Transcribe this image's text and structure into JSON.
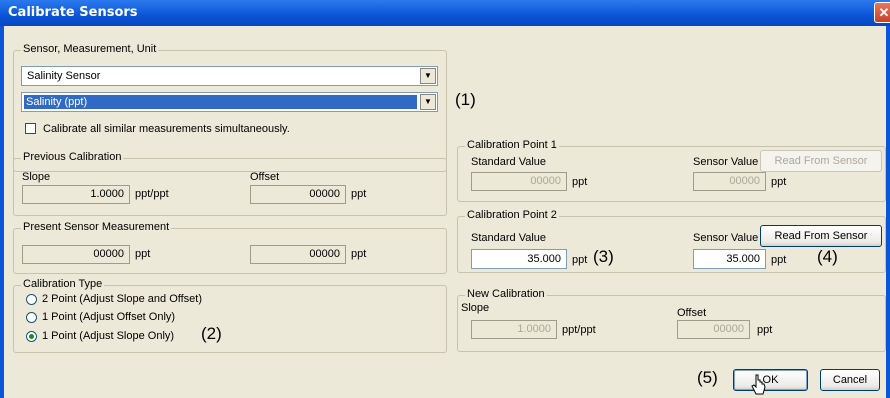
{
  "window": {
    "title": "Calibrate Sensors",
    "close_glyph": "✕"
  },
  "sensor_group": {
    "legend": "Sensor, Measurement, Unit",
    "sensor_select": "Salinity Sensor",
    "measurement_select": "Salinity (ppt)",
    "calibrate_all_label": "Calibrate all similar measurements simultaneously."
  },
  "previous_calibration": {
    "legend": "Previous Calibration",
    "slope_label": "Slope",
    "slope_value": "1.0000",
    "slope_unit": "ppt/ppt",
    "offset_label": "Offset",
    "offset_value": "00000",
    "offset_unit": "ppt"
  },
  "present_measurement": {
    "legend": "Present Sensor Measurement",
    "value1": "00000",
    "unit1": "ppt",
    "value2": "00000",
    "unit2": "ppt"
  },
  "calibration_type": {
    "legend": "Calibration Type",
    "options": [
      {
        "label": "2 Point (Adjust Slope and Offset)",
        "checked": false
      },
      {
        "label": "1 Point (Adjust Offset Only)",
        "checked": false
      },
      {
        "label": "1 Point (Adjust Slope Only)",
        "checked": true
      }
    ]
  },
  "point1": {
    "legend": "Calibration Point 1",
    "standard_label": "Standard Value",
    "standard_value": "00000",
    "standard_unit": "ppt",
    "sensor_label": "Sensor Value",
    "sensor_value": "00000",
    "sensor_unit": "ppt",
    "read_button": "Read From Sensor"
  },
  "point2": {
    "legend": "Calibration Point 2",
    "standard_label": "Standard Value",
    "standard_value": "35.000",
    "standard_unit": "ppt",
    "sensor_label": "Sensor Value",
    "sensor_value": "35.000",
    "sensor_unit": "ppt",
    "read_button": "Read From Sensor"
  },
  "new_calibration": {
    "legend": "New Calibration",
    "slope_label": "Slope",
    "slope_value": "1.0000",
    "slope_unit": "ppt/ppt",
    "offset_label": "Offset",
    "offset_value": "00000",
    "offset_unit": "ppt"
  },
  "buttons": {
    "ok": "OK",
    "cancel": "Cancel"
  },
  "annotations": {
    "a1": "(1)",
    "a2": "(2)",
    "a3": "(3)",
    "a4": "(4)",
    "a5": "(5)"
  },
  "colors": {
    "title_bar": "#0a55d6",
    "dialog_bg": "#ece9d8",
    "selection": "#316ac5"
  }
}
